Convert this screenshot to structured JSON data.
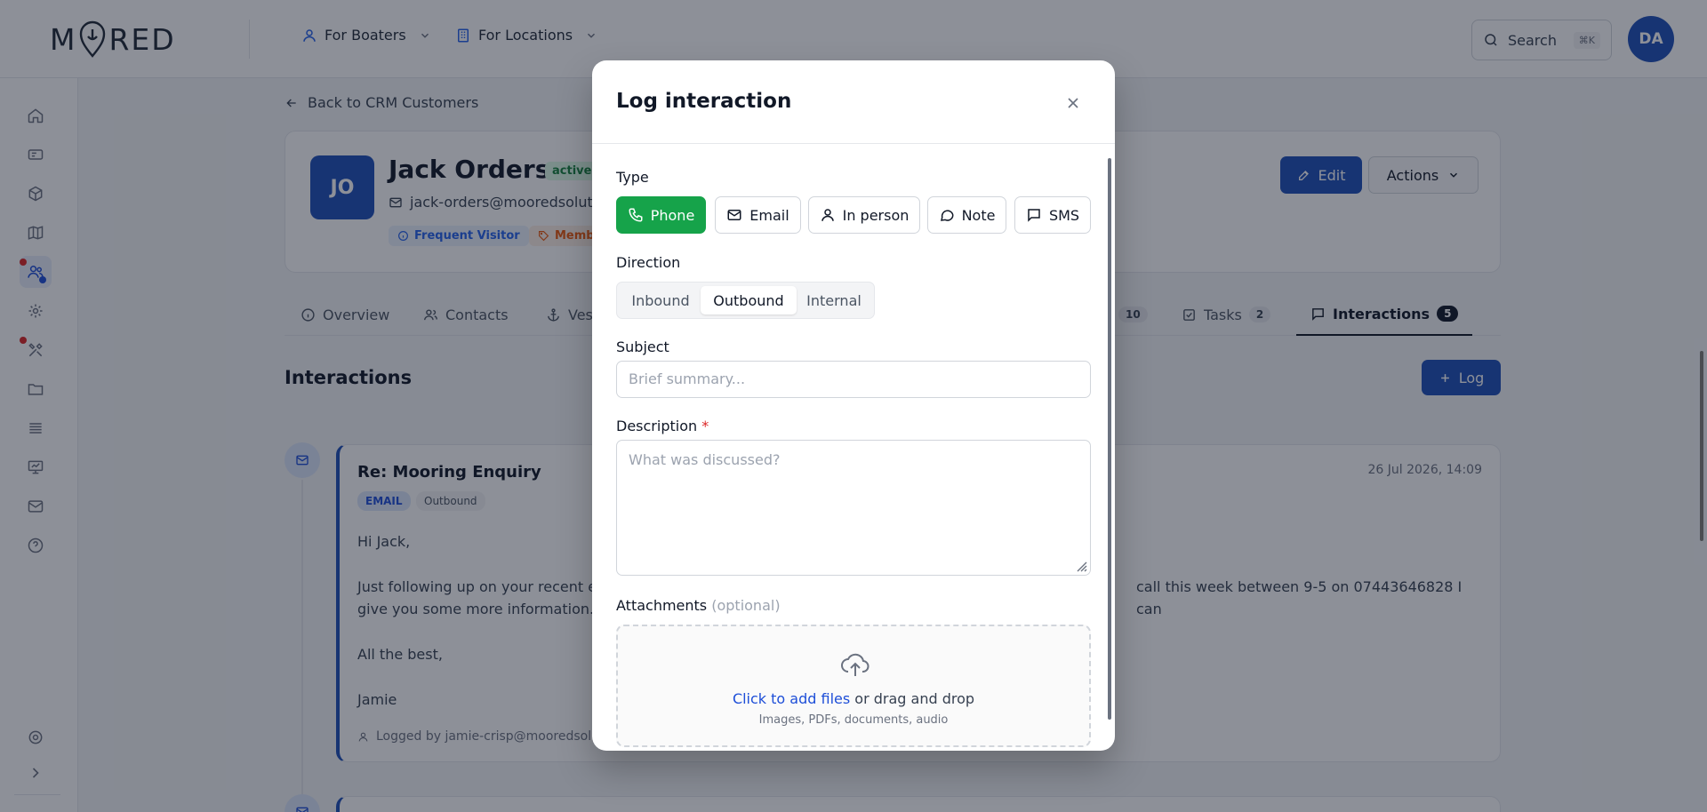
{
  "brand": {
    "logo_left": "M",
    "logo_right": "RED"
  },
  "topnav": {
    "boaters": "For Boaters",
    "locations": "For Locations"
  },
  "search": {
    "label": "Search",
    "shortcut": "⌘K"
  },
  "user": {
    "initials": "DA"
  },
  "back_link": "Back to CRM Customers",
  "customer": {
    "initials": "JO",
    "name": "Jack Orders",
    "status": "active",
    "email": "jack-orders@mooredsoluti",
    "tags": [
      "Frequent Visitor",
      "Memb"
    ],
    "edit_label": "Edit",
    "actions_label": "Actions"
  },
  "tabs": [
    {
      "label": "Overview"
    },
    {
      "label": "Contacts"
    },
    {
      "label": "Ves"
    },
    {
      "label": "",
      "count": "10"
    },
    {
      "label": "Tasks",
      "count": "2"
    },
    {
      "label": "Interactions",
      "count": "5"
    }
  ],
  "interactions": {
    "title": "Interactions",
    "log_label": "Log",
    "item": {
      "subject": "Re: Mooring Enquiry",
      "date": "26 Jul 2026, 14:09",
      "type_badge": "EMAIL",
      "direction_badge": "Outbound",
      "greeting": "Hi Jack,",
      "body_left": "Just following up on your recent er",
      "body_right": "call this week between 9-5 on 07443646828 I can",
      "body_line2": "give you some more information.",
      "signoff": "All the best,",
      "signature": "Jamie",
      "logged_by": "Logged by jamie-crisp@mooredsoluti"
    }
  },
  "modal": {
    "title": "Log interaction",
    "type_label": "Type",
    "types": [
      "Phone",
      "Email",
      "In person",
      "Note",
      "SMS"
    ],
    "selected_type": "Phone",
    "direction_label": "Direction",
    "directions": [
      "Inbound",
      "Outbound",
      "Internal"
    ],
    "selected_direction": "Outbound",
    "subject_label": "Subject",
    "subject_placeholder": "Brief summary...",
    "description_label": "Description",
    "description_required": "*",
    "description_placeholder": "What was discussed?",
    "attachments_label": "Attachments",
    "attachments_optional": "(optional)",
    "dropzone_link": "Click to add files",
    "dropzone_text": " or drag and drop",
    "dropzone_sub": "Images, PDFs, documents, audio"
  },
  "colors": {
    "primary": "#1e4fb8",
    "success": "#16a34a",
    "danger": "#dc2626"
  }
}
